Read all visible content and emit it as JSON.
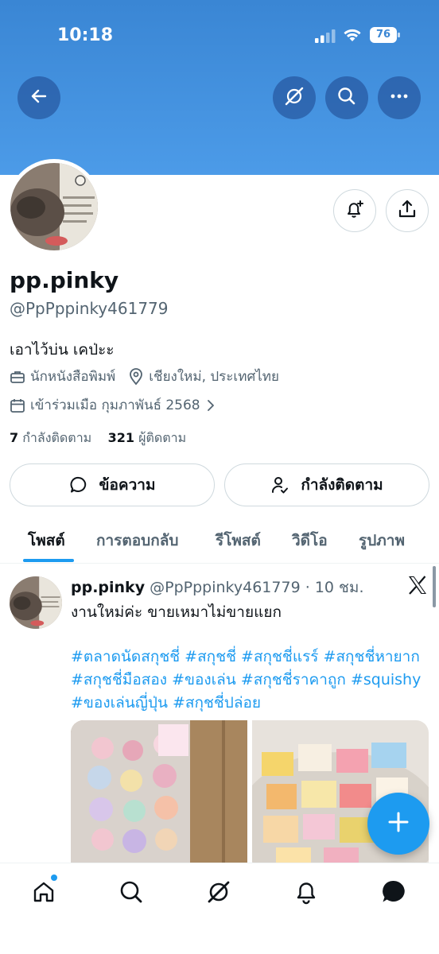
{
  "status_bar": {
    "time": "10:18",
    "battery": "76"
  },
  "profile": {
    "display_name": "pp.pinky",
    "handle": "@PpPppinky461779",
    "bio": "เอาไว้บ่น เคป่ะะ",
    "profession": "นักหนังสือพิมพ์",
    "location": "เชียงใหม่, ประเทศไทย",
    "joined": "เข้าร่วมเมือ กุมภาพันธ์ 2568",
    "following_count": "7",
    "following_label": "กำลังติดตาม",
    "followers_count": "321",
    "followers_label": "ผู้ติดตาม"
  },
  "actions": {
    "message_label": "ข้อความ",
    "following_button_label": "กำลังติดตาม"
  },
  "tabs": [
    {
      "label": "โพสต์",
      "active": true
    },
    {
      "label": "การตอบกลับ",
      "active": false
    },
    {
      "label": "รีโพสต์",
      "active": false
    },
    {
      "label": "วิดีโอ",
      "active": false
    },
    {
      "label": "รูปภาพ",
      "active": false
    }
  ],
  "post": {
    "author_name": "pp.pinky",
    "author_handle": "@PpPppinky461779",
    "separator": "·",
    "time": "10 ชม.",
    "text": "งานใหม่ค่ะ ขายเหมาไม่ขายแยก",
    "hashtags": "#ตลาดนัดสกุชชี่ #สกุชชี่ #สกุชชี่แรร์ #สกุชชี่หายาก #สกุชชี่มือสอง #ของเล่น #สกุชชี่ราคาถูก #squishy #ของเล่นญี่ปุ่น #สกุชชี่ปล่อย"
  },
  "colors": {
    "banner": "#4c9be8",
    "accent": "#1d9bf0",
    "text_primary": "#0f1419",
    "text_secondary": "#536471",
    "border": "#cfd9de"
  },
  "icons": {
    "back": "arrow-left-icon",
    "grok": "grok-icon",
    "search": "search-icon",
    "more": "more-icon",
    "notify": "bell-plus-icon",
    "share": "share-icon",
    "message": "message-bubble-icon",
    "following": "person-check-icon",
    "x_logo": "x-logo-icon",
    "compose": "plus-icon",
    "nav": [
      "home-icon",
      "search-icon",
      "grok-icon",
      "bell-icon",
      "messages-icon"
    ]
  }
}
